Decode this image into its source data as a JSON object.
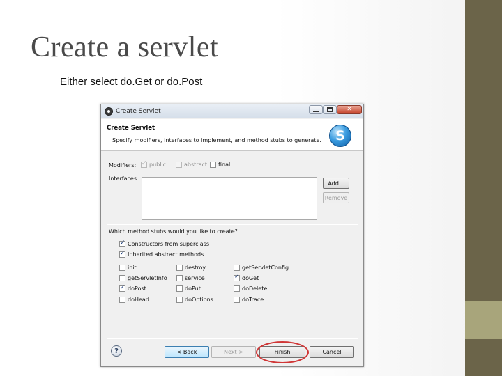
{
  "slide": {
    "title": "Create a servlet",
    "subtitle": "Either select do.Get or do.Post"
  },
  "dialog": {
    "window_title": "Create Servlet",
    "header_title": "Create Servlet",
    "header_desc": "Specify modifiers, interfaces to implement, and method stubs to generate.",
    "logo_letter": "S",
    "modifiers_label": "Modifiers:",
    "modifiers": [
      {
        "label": "public",
        "checked": true,
        "enabled": false
      },
      {
        "label": "abstract",
        "checked": false,
        "enabled": false
      },
      {
        "label": "final",
        "checked": false,
        "enabled": true
      }
    ],
    "interfaces_label": "Interfaces:",
    "add_label": "Add...",
    "remove_label": "Remove",
    "stubs_question": "Which method stubs would you like to create?",
    "stub_options_top": [
      {
        "label": "Constructors from superclass",
        "checked": true
      },
      {
        "label": "Inherited abstract methods",
        "checked": true
      }
    ],
    "stub_methods": [
      {
        "label": "init",
        "checked": false
      },
      {
        "label": "destroy",
        "checked": false
      },
      {
        "label": "getServletConfig",
        "checked": false
      },
      {
        "label": "getServletInfo",
        "checked": false
      },
      {
        "label": "service",
        "checked": false
      },
      {
        "label": "doGet",
        "checked": true
      },
      {
        "label": "doPost",
        "checked": true
      },
      {
        "label": "doPut",
        "checked": false
      },
      {
        "label": "doDelete",
        "checked": false
      },
      {
        "label": "doHead",
        "checked": false
      },
      {
        "label": "doOptions",
        "checked": false
      },
      {
        "label": "doTrace",
        "checked": false
      }
    ],
    "buttons": {
      "back": "< Back",
      "next": "Next >",
      "finish": "Finish",
      "cancel": "Cancel"
    },
    "help_glyph": "?"
  },
  "colors": {
    "side_bar_dark": "#6b6449",
    "side_bar_light": "#a8a57b",
    "highlight_ring": "#d03636"
  }
}
